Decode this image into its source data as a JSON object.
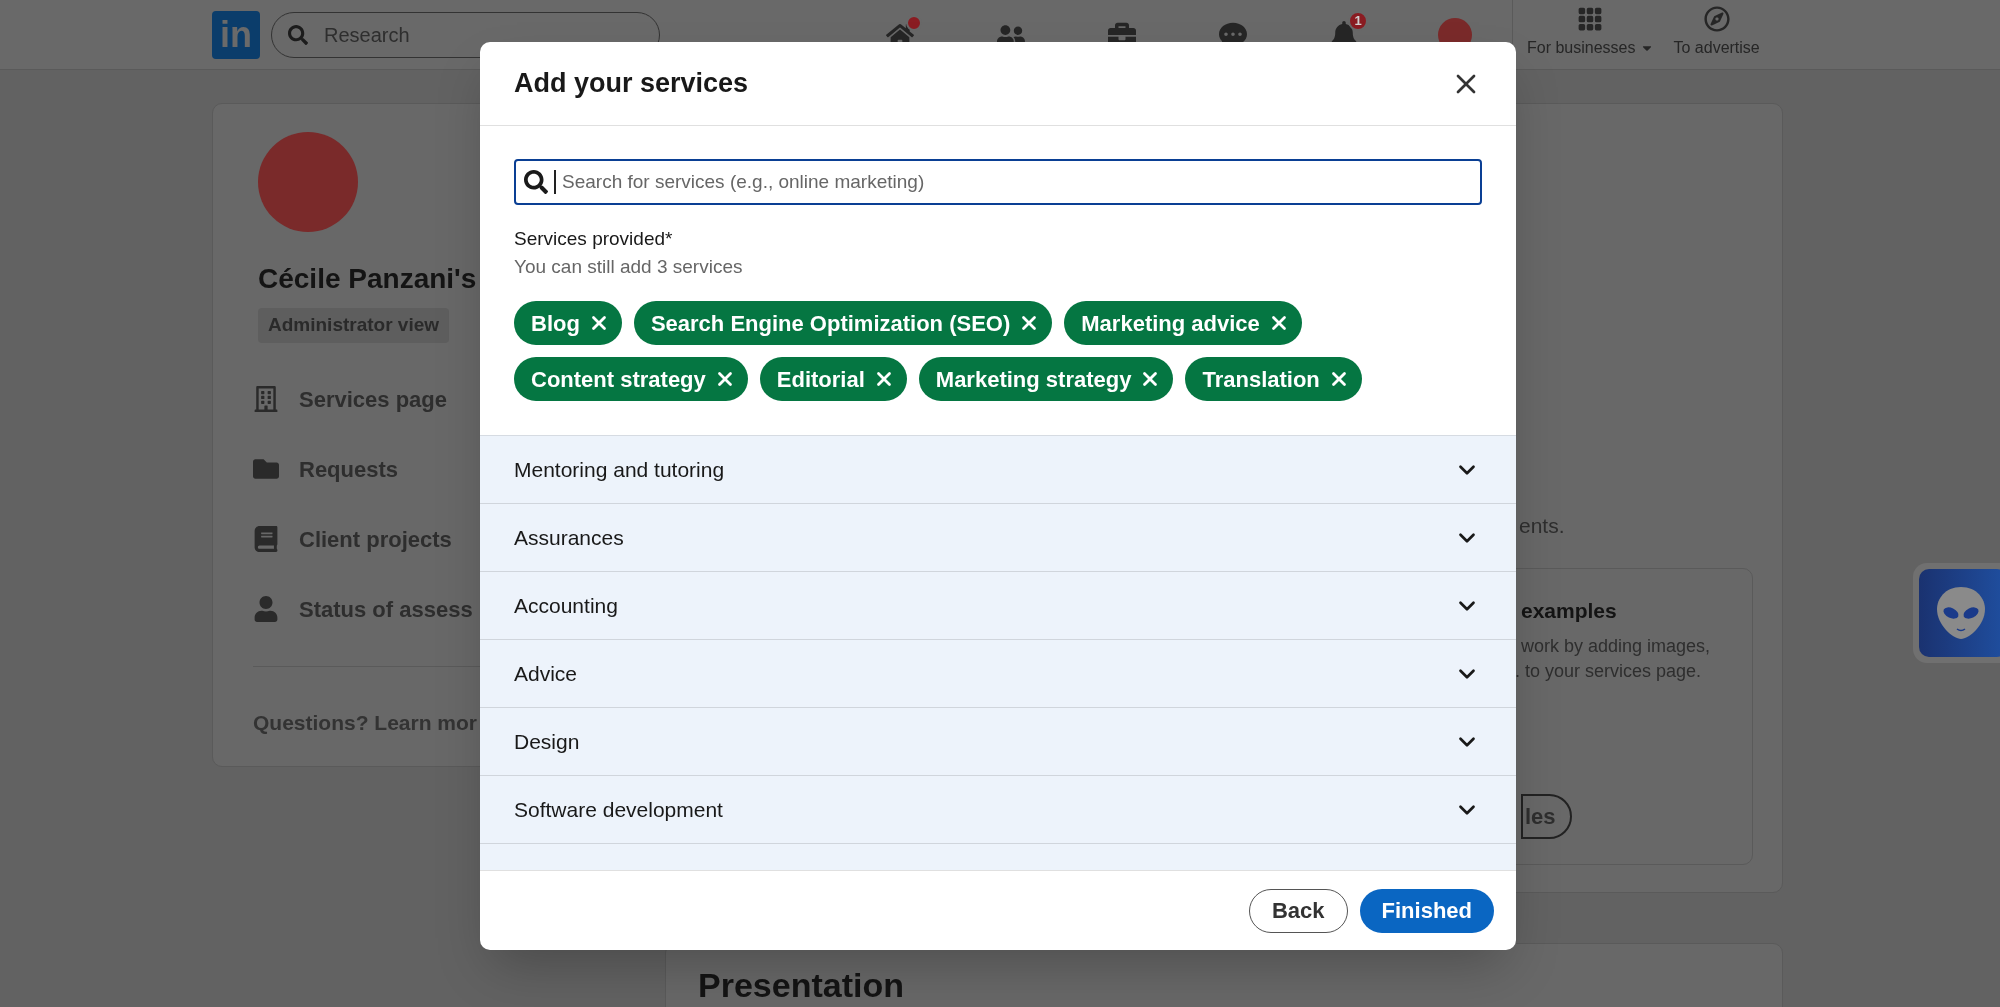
{
  "nav": {
    "logo": "in",
    "search_placeholder": "Research",
    "notification_count": "1",
    "links": [
      {
        "label": "For businesses",
        "dropdown": true
      },
      {
        "label": "To advertise",
        "dropdown": false
      }
    ]
  },
  "sidebar": {
    "name": "Cécile Panzani's",
    "badge": "Administrator view",
    "items": [
      "Services page",
      "Requests",
      "Client projects",
      "Status of assess"
    ],
    "footer": "Questions? Learn mor"
  },
  "page": {
    "text_fragment": "ents.",
    "examples_title": "examples",
    "examples_text": "work by adding images,",
    "examples_text_2": ". to your services page.",
    "examples_button": "les",
    "section_title": "Presentation"
  },
  "modal": {
    "title": "Add your services",
    "search_placeholder": "Search for services (e.g., online marketing)",
    "label": "Services provided*",
    "hint": "You can still add 3 services",
    "chips": [
      "Blog",
      "Search Engine Optimization (SEO)",
      "Marketing advice",
      "Content strategy",
      "Editorial",
      "Marketing strategy",
      "Translation"
    ],
    "categories": [
      {
        "label": "Mentoring and tutoring",
        "expanded": false
      },
      {
        "label": "Assurances",
        "expanded": false
      },
      {
        "label": "Accounting",
        "expanded": false
      },
      {
        "label": "Advice",
        "expanded": false
      },
      {
        "label": "Design",
        "expanded": false
      },
      {
        "label": "Software development",
        "expanded": false
      }
    ],
    "buttons": [
      {
        "label": "Back",
        "kind": "secondary"
      },
      {
        "label": "Finished",
        "kind": "primary"
      }
    ]
  }
}
